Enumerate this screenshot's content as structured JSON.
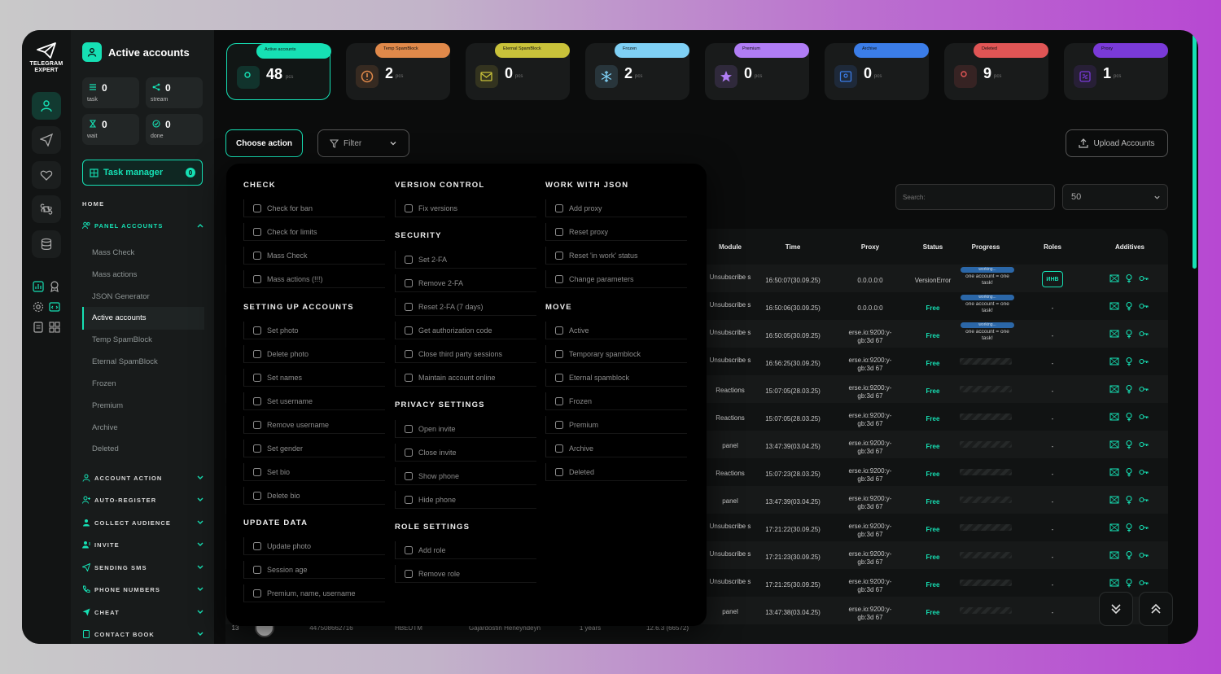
{
  "brand": {
    "line1": "TELEGRAM",
    "line2": "EXPERT"
  },
  "sidebar": {
    "title": "Active accounts",
    "stats": [
      {
        "value": "0",
        "label": "task"
      },
      {
        "value": "0",
        "label": "stream"
      },
      {
        "value": "0",
        "label": "wait"
      },
      {
        "value": "0",
        "label": "done"
      }
    ],
    "task_manager": {
      "label": "Task manager",
      "count": "0"
    },
    "home": "HOME",
    "panel_accounts": "PANEL ACCOUNTS",
    "sub_items": [
      "Mass Check",
      "Mass actions",
      "JSON Generator",
      "Active accounts",
      "Temp SpamBlock",
      "Eternal SpamBlock",
      "Frozen",
      "Premium",
      "Archive",
      "Deleted"
    ],
    "sections": [
      "ACCOUNT ACTION",
      "AUTO-REGISTER",
      "COLLECT AUDIENCE",
      "INVITE",
      "SENDING SMS",
      "PHONE NUMBERS",
      "CHEAT",
      "CONTACT BOOK"
    ]
  },
  "cards": [
    {
      "label": "Active accounts",
      "value": "48",
      "unit": "pcs",
      "color": "#16e0b4",
      "icon": "user-check-icon"
    },
    {
      "label": "Temp SpamBlock",
      "value": "2",
      "unit": "pcs",
      "color": "#e0894a",
      "icon": "alert-circle-icon"
    },
    {
      "label": "Eternal SpamBlock",
      "value": "0",
      "unit": "pcs",
      "color": "#c9c23a",
      "icon": "mail-block-icon"
    },
    {
      "label": "Frozen",
      "value": "2",
      "unit": "pcs",
      "color": "#7fd0f5",
      "icon": "snowflake-icon"
    },
    {
      "label": "Premium",
      "value": "0",
      "unit": "pcs",
      "color": "#b07df5",
      "icon": "star-icon"
    },
    {
      "label": "Archive",
      "value": "0",
      "unit": "pcs",
      "color": "#3b7de8",
      "icon": "archive-icon"
    },
    {
      "label": "Deleted",
      "value": "9",
      "unit": "pcs",
      "color": "#e05555",
      "icon": "user-x-icon"
    },
    {
      "label": "Proxy",
      "value": "1",
      "unit": "pcs",
      "color": "#7a3ad8",
      "icon": "proxy-icon"
    }
  ],
  "toolbar": {
    "choose": "Choose action",
    "filter": "Filter",
    "upload": "Upload Accounts",
    "search_placeholder": "Search:",
    "per_page": "50"
  },
  "table": {
    "headers": [
      "Module",
      "Time",
      "Proxy",
      "Status",
      "Progress",
      "Roles",
      "Additives"
    ],
    "rows": [
      {
        "module": "Unsubscribe s",
        "time": "16:50:07(30.09.25)",
        "proxy": "0.0.0.0:0",
        "status": "VersionError",
        "progress": "one account = one task!",
        "progress_label": "working...",
        "role": "ИНВ"
      },
      {
        "module": "Unsubscribe s",
        "time": "16:50:06(30.09.25)",
        "proxy": "0.0.0.0:0",
        "status": "Free",
        "progress": "one account = one task!",
        "progress_label": "working...",
        "role": "-"
      },
      {
        "module": "Unsubscribe s",
        "time": "16:50:05(30.09.25)",
        "proxy": "erse.io:9200:y-gb:3d 67",
        "status": "Free",
        "progress": "one account = one task!",
        "progress_label": "working...",
        "role": "-"
      },
      {
        "module": "Unsubscribe s",
        "time": "16:56:25(30.09.25)",
        "proxy": "erse.io:9200:y-gb:3d 67",
        "status": "Free",
        "progress": "",
        "role": "-"
      },
      {
        "module": "Reactions",
        "time": "15:07:05(28.03.25)",
        "proxy": "erse.io:9200:y-gb:3d 67",
        "status": "Free",
        "progress": "",
        "role": "-"
      },
      {
        "module": "Reactions",
        "time": "15:07:05(28.03.25)",
        "proxy": "erse.io:9200:y-gb:3d 67",
        "status": "Free",
        "progress": "",
        "role": "-"
      },
      {
        "module": "panel",
        "time": "13:47:39(03.04.25)",
        "proxy": "erse.io:9200:y-gb:3d 67",
        "status": "Free",
        "progress": "",
        "role": "-"
      },
      {
        "module": "Reactions",
        "time": "15:07:23(28.03.25)",
        "proxy": "erse.io:9200:y-gb:3d 67",
        "status": "Free",
        "progress": "",
        "role": "-"
      },
      {
        "module": "panel",
        "time": "13:47:39(03.04.25)",
        "proxy": "erse.io:9200:y-gb:3d 67",
        "status": "Free",
        "progress": "",
        "role": "-"
      },
      {
        "module": "Unsubscribe s",
        "time": "17:21:22(30.09.25)",
        "proxy": "erse.io:9200:y-gb:3d 67",
        "status": "Free",
        "progress": "",
        "role": "-"
      },
      {
        "module": "Unsubscribe s",
        "time": "17:21:23(30.09.25)",
        "proxy": "erse.io:9200:y-gb:3d 67",
        "status": "Free",
        "progress": "",
        "role": "-"
      },
      {
        "module": "Unsubscribe s",
        "time": "17:21:25(30.09.25)",
        "proxy": "erse.io:9200:y-gb:3d 67",
        "status": "Free",
        "progress": "",
        "role": "-"
      },
      {
        "module": "panel",
        "time": "13:47:38(03.04.25)",
        "proxy": "erse.io:9200:y-gb:3d 67",
        "status": "Free",
        "progress": "",
        "role": "-"
      }
    ],
    "last_row": {
      "index": "13",
      "phone": "447508662716",
      "username": "HBEUTM",
      "name": "Gajardostin Heneyndeyn",
      "age": "1 years",
      "version": "12.6.3 (66572)"
    }
  },
  "menu": {
    "check": {
      "title": "CHECK",
      "items": [
        "Check for ban",
        "Check for limits",
        "Mass Check",
        "Mass actions (!!!)"
      ]
    },
    "setup": {
      "title": "SETTING UP ACCOUNTS",
      "items": [
        "Set photo",
        "Delete photo",
        "Set names",
        "Set username",
        "Remove username",
        "Set gender",
        "Set bio",
        "Delete bio"
      ]
    },
    "update": {
      "title": "UPDATE DATA",
      "items": [
        "Update photo",
        "Session age",
        "Premium, name, username"
      ]
    },
    "version": {
      "title": "VERSION CONTROL",
      "items": [
        "Fix versions"
      ]
    },
    "security": {
      "title": "SECURITY",
      "items": [
        "Set 2-FA",
        "Remove 2-FA",
        "Reset 2-FA (7 days)",
        "Get authorization code",
        "Close third party sessions",
        "Maintain account online"
      ]
    },
    "privacy": {
      "title": "PRIVACY SETTINGS",
      "items": [
        "Open invite",
        "Close invite",
        "Show phone",
        "Hide phone"
      ]
    },
    "roles": {
      "title": "ROLE SETTINGS",
      "items": [
        "Add role",
        "Remove role"
      ]
    },
    "json": {
      "title": "WORK WITH JSON",
      "items": [
        "Add proxy",
        "Reset proxy",
        "Reset 'in work' status",
        "Change parameters"
      ]
    },
    "move": {
      "title": "MOVE",
      "items": [
        "Active",
        "Temporary spamblock",
        "Eternal spamblock",
        "Frozen",
        "Premium",
        "Archive",
        "Deleted"
      ]
    }
  }
}
